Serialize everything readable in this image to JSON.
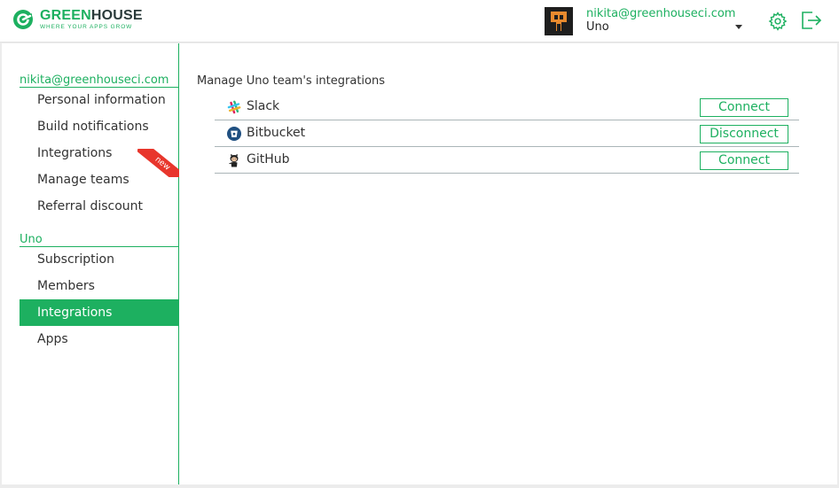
{
  "brand": {
    "name_green": "GREEN",
    "name_dark": "HOUSE",
    "tagline": "WHERE YOUR APPS GROW"
  },
  "header": {
    "user_email": "nikita@greenhouseci.com",
    "team_name": "Uno",
    "icons": {
      "settings": "gear-icon",
      "logout": "logout-icon",
      "dropdown": "chevron-down-icon"
    }
  },
  "sidebar": {
    "account_group": "nikita@greenhouseci.com",
    "account_items": [
      {
        "label": "Personal information"
      },
      {
        "label": "Build notifications"
      },
      {
        "label": "Integrations"
      },
      {
        "label": "Manage teams"
      },
      {
        "label": "Referral discount",
        "badge": "new"
      }
    ],
    "team_group": "Uno",
    "team_items": [
      {
        "label": "Subscription"
      },
      {
        "label": "Members"
      },
      {
        "label": "Integrations",
        "active": true
      },
      {
        "label": "Apps"
      }
    ]
  },
  "main": {
    "title": "Manage Uno team's integrations",
    "integrations": [
      {
        "name": "Slack",
        "icon": "slack-icon",
        "action": "Connect"
      },
      {
        "name": "Bitbucket",
        "icon": "bitbucket-icon",
        "action": "Disconnect"
      },
      {
        "name": "GitHub",
        "icon": "github-icon",
        "action": "Connect"
      }
    ]
  },
  "colors": {
    "accent": "#1db060",
    "badge": "#e8362c",
    "divider": "#aab5b8"
  }
}
